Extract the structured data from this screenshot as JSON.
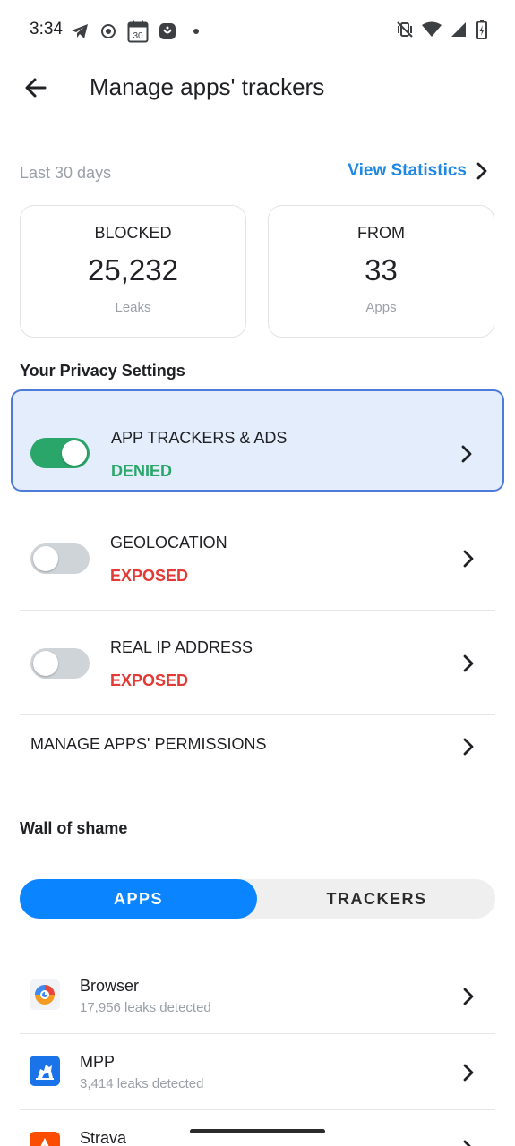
{
  "status_bar": {
    "time": "3:34",
    "left_icons": [
      "telegram-icon",
      "record-icon",
      "calendar-icon",
      "app-notification-icon",
      "dot-icon"
    ],
    "calendar_day": "30",
    "right_icons": [
      "vibrate-off-icon",
      "wifi-icon",
      "cell-signal-icon",
      "battery-icon"
    ]
  },
  "header": {
    "title": "Manage apps' trackers"
  },
  "summary": {
    "period": "Last 30 days",
    "view_stats_label": "View Statistics",
    "cards": [
      {
        "title": "BLOCKED",
        "value": "25,232",
        "sub": "Leaks"
      },
      {
        "title": "FROM",
        "value": "33",
        "sub": "Apps"
      }
    ]
  },
  "privacy": {
    "section_title": "Your Privacy Settings",
    "settings": [
      {
        "name": "APP TRACKERS & ADS",
        "status": "DENIED",
        "enabled": true
      },
      {
        "name": "GEOLOCATION",
        "status": "EXPOSED",
        "enabled": false
      },
      {
        "name": "REAL IP ADDRESS",
        "status": "EXPOSED",
        "enabled": false
      }
    ],
    "manage_permissions_label": "MANAGE APPS' PERMISSIONS"
  },
  "wall_of_shame": {
    "section_title": "Wall of shame",
    "tabs": [
      {
        "label": "APPS",
        "selected": true
      },
      {
        "label": "TRACKERS",
        "selected": false
      }
    ],
    "apps": [
      {
        "name": "Browser",
        "leaks": "17,956 leaks detected",
        "icon": "browser-icon"
      },
      {
        "name": "MPP",
        "leaks": "3,414 leaks detected",
        "icon": "mpp-icon"
      },
      {
        "name": "Strava",
        "leaks": "",
        "icon": "strava-icon"
      }
    ]
  },
  "colors": {
    "accent": "#0a84ff",
    "denied": "#2aa66a",
    "exposed": "#e53935",
    "active_row_bg": "#e4edfb",
    "active_row_border": "#4c7bd9"
  }
}
